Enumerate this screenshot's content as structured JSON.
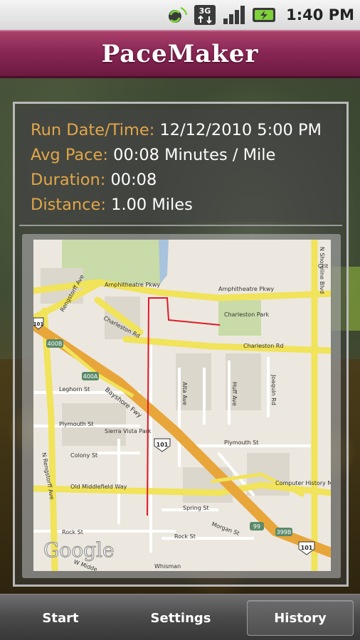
{
  "status_bar": {
    "time": "1:40 PM",
    "network_label": "3G",
    "icons": [
      "sync-icon",
      "network-3g-icon",
      "signal-icon",
      "battery-charging-icon"
    ]
  },
  "app": {
    "title": "PaceMaker"
  },
  "run": {
    "date_label": "Run Date/Time:",
    "date_value": "12/12/2010 5:00 PM",
    "pace_label": "Avg Pace:",
    "pace_value": "00:08 Minutes / Mile",
    "duration_label": "Duration:",
    "duration_value": "00:08",
    "distance_label": "Distance:",
    "distance_value": "1.00 Miles"
  },
  "map": {
    "attribution": "Google",
    "labels": {
      "amphitheatre_pkwy_top": "Amphitheatre Pkwy",
      "amphitheatre_pkwy_right": "Amphitheatre Pkwy",
      "charleston_rd_left": "Charleston Rd",
      "charleston_rd_right": "Charleston Rd",
      "charleston_park": "Charleston Park",
      "bayshore_fwy": "Bayshore Fwy",
      "rengstorff_ave_top": "Rengstorff Ave",
      "rengstorff_ave_left": "N Rengstorff Ave",
      "n_shoreline_blvd": "N Shoreline Blvd",
      "leghorn_st": "Leghorn St",
      "plymouth_st_left": "Plymouth St",
      "plymouth_st_right": "Plymouth St",
      "sierra_vista_park": "Sierra Vista Park",
      "colony_st": "Colony St",
      "old_middlefield": "Old Middlefield Way",
      "spring_st": "Spring St",
      "rock_st_left": "Rock St",
      "rock_st_right": "Rock St",
      "morgan_st": "Morgan St",
      "alta_ave": "Alta Ave",
      "huff_ave": "Huff Ave",
      "joaquin_rd": "Joaquin Rd",
      "computer_history_museum": "Computer History Museum",
      "whisman": "Whisman",
      "w_middlefield": "W Midde",
      "route_400b": "400B",
      "route_400a": "400A",
      "route_101_mid": "101",
      "route_101_right": "101",
      "route_399b": "399B",
      "route_99": "99",
      "route_101_left": "101",
      "crit": "Crit"
    }
  },
  "nav": {
    "start": "Start",
    "settings": "Settings",
    "history": "History"
  }
}
